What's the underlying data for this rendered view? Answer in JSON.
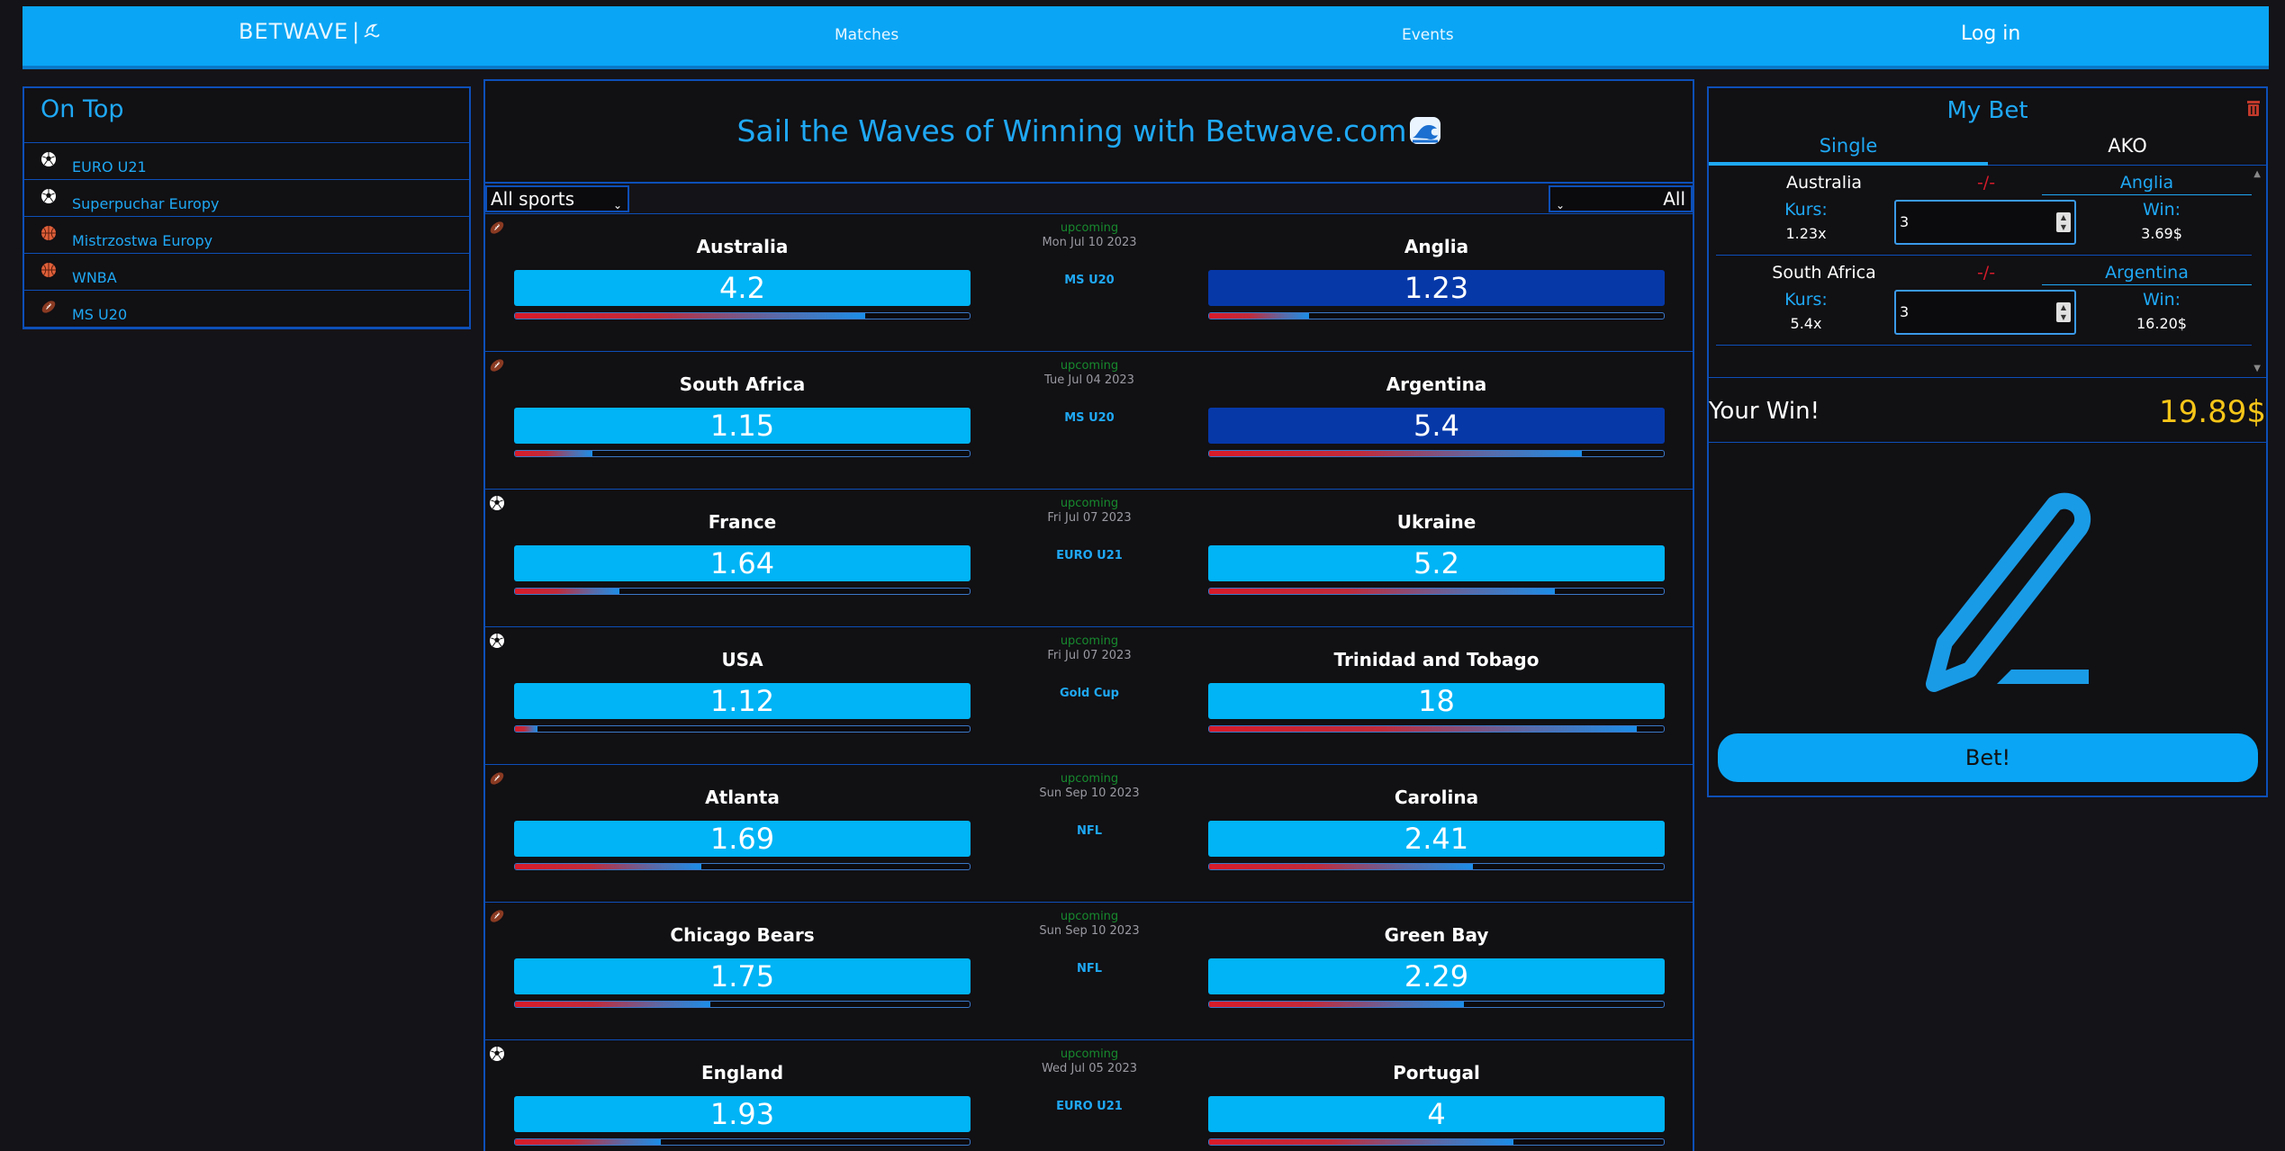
{
  "header": {
    "brand": "BETWAVE",
    "nav": {
      "matches": "Matches",
      "events": "Events",
      "login": "Log in"
    }
  },
  "on_top": {
    "title": "On Top",
    "items": [
      {
        "label": "EURO U21",
        "icon": "soccer-ball-icon"
      },
      {
        "label": "Superpuchar Europy",
        "icon": "soccer-ball-icon"
      },
      {
        "label": "Mistrzostwa Europy",
        "icon": "basketball-icon"
      },
      {
        "label": "WNBA",
        "icon": "basketball-icon"
      },
      {
        "label": "MS U20",
        "icon": "american-football-icon"
      }
    ]
  },
  "hero": {
    "title": "Sail the Waves of Winning with Betwave.com"
  },
  "filters": {
    "sport": "All sports",
    "scope": "All"
  },
  "matches": [
    {
      "home": "Australia",
      "away": "Anglia",
      "home_odd": "4.2",
      "away_odd": "1.23",
      "status": "upcoming",
      "date": "Mon Jul 10 2023",
      "league": "MS U20",
      "icon": "american-football-icon",
      "home_fill": 0.77,
      "away_fill": 0.22,
      "selected": "away"
    },
    {
      "home": "South Africa",
      "away": "Argentina",
      "home_odd": "1.15",
      "away_odd": "5.4",
      "status": "upcoming",
      "date": "Tue Jul 04 2023",
      "league": "MS U20",
      "icon": "american-football-icon",
      "home_fill": 0.17,
      "away_fill": 0.82,
      "selected": "away"
    },
    {
      "home": "France",
      "away": "Ukraine",
      "home_odd": "1.64",
      "away_odd": "5.2",
      "status": "upcoming",
      "date": "Fri Jul 07 2023",
      "league": "EURO U21",
      "icon": "soccer-ball-icon",
      "home_fill": 0.23,
      "away_fill": 0.76,
      "selected": ""
    },
    {
      "home": "USA",
      "away": "Trinidad and Tobago",
      "home_odd": "1.12",
      "away_odd": "18",
      "status": "upcoming",
      "date": "Fri Jul 07 2023",
      "league": "Gold Cup",
      "icon": "soccer-ball-icon",
      "home_fill": 0.05,
      "away_fill": 0.94,
      "selected": ""
    },
    {
      "home": "Atlanta",
      "away": "Carolina",
      "home_odd": "1.69",
      "away_odd": "2.41",
      "status": "upcoming",
      "date": "Sun Sep 10 2023",
      "league": "NFL",
      "icon": "american-football-icon",
      "home_fill": 0.41,
      "away_fill": 0.58,
      "selected": ""
    },
    {
      "home": "Chicago Bears",
      "away": "Green Bay",
      "home_odd": "1.75",
      "away_odd": "2.29",
      "status": "upcoming",
      "date": "Sun Sep 10 2023",
      "league": "NFL",
      "icon": "american-football-icon",
      "home_fill": 0.43,
      "away_fill": 0.56,
      "selected": ""
    },
    {
      "home": "England",
      "away": "Portugal",
      "home_odd": "1.93",
      "away_odd": "4",
      "status": "upcoming",
      "date": "Wed Jul 05 2023",
      "league": "EURO U21",
      "icon": "soccer-ball-icon",
      "home_fill": 0.32,
      "away_fill": 0.67,
      "selected": ""
    }
  ],
  "my_bet": {
    "title": "My Bet",
    "tabs": {
      "single": "Single",
      "ako": "AKO"
    },
    "bets": [
      {
        "home": "Australia",
        "separator": "-/-",
        "away": "Anglia",
        "kurs_label": "Kurs:",
        "kurs": "1.23x",
        "stake": "3",
        "win_label": "Win:",
        "win": "3.69$"
      },
      {
        "home": "South Africa",
        "separator": "-/-",
        "away": "Argentina",
        "kurs_label": "Kurs:",
        "kurs": "5.4x",
        "stake": "3",
        "win_label": "Win:",
        "win": "16.20$"
      }
    ],
    "your_win_label": "Your Win!",
    "your_win": "19.89$",
    "bet_button": "Bet!"
  },
  "colors": {
    "accent": "#0aa5f5",
    "border": "#0d4fb8",
    "background": "#141317",
    "win": "#f5c518",
    "danger": "#d81b2a",
    "selected_odd": "#0638a8"
  }
}
